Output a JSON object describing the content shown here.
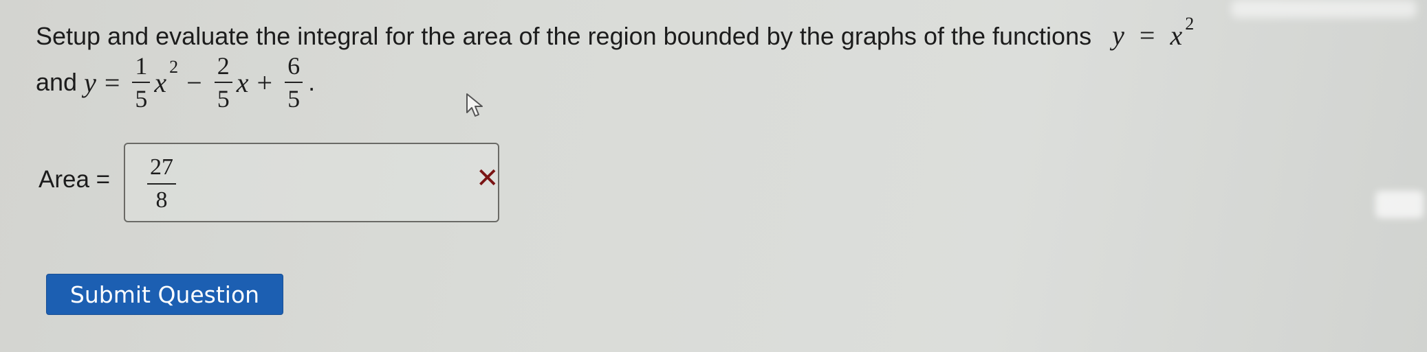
{
  "question": {
    "intro": "Setup and evaluate the integral for the area of the region bounded by the graphs of the functions",
    "func1": {
      "var": "y",
      "eq": "=",
      "base": "x",
      "exp": "2"
    },
    "and": "and",
    "func2": {
      "var": "y",
      "eq": "=",
      "t1": {
        "num": "1",
        "den": "5",
        "var": "x",
        "exp": "2"
      },
      "minus": "−",
      "t2": {
        "num": "2",
        "den": "5",
        "var": "x"
      },
      "plus": "+",
      "t3": {
        "num": "6",
        "den": "5"
      },
      "end": "."
    }
  },
  "answer": {
    "label": "Area =",
    "value_num": "27",
    "value_den": "8",
    "status_mark": "✕",
    "status_color": "#7a1414"
  },
  "submit_label": "Submit Question",
  "accent": "#1c5fb2"
}
